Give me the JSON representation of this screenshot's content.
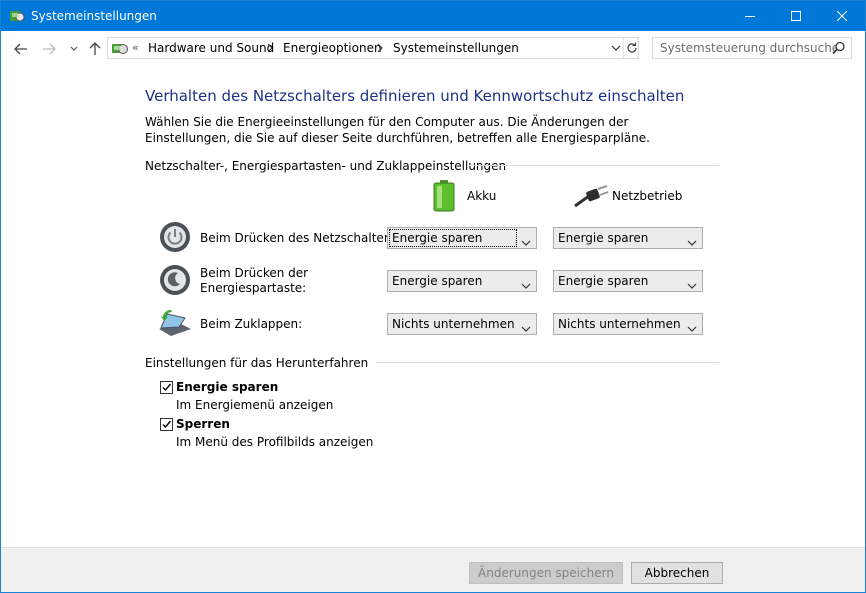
{
  "window": {
    "title": "Systemeinstellungen"
  },
  "address": {
    "overflow": "«",
    "crumbs": [
      "Hardware und Sound",
      "Energieoptionen",
      "Systemeinstellungen"
    ]
  },
  "search": {
    "placeholder": "Systemsteuerung durchsuchen"
  },
  "main": {
    "heading": "Verhalten des Netzschalters definieren und Kennwortschutz einschalten",
    "intro": "Wählen Sie die Energieeinstellungen für den Computer aus. Die Änderungen der Einstellungen, die Sie auf dieser Seite durchführen, betreffen alle Energiesparpläne.",
    "group1_title": "Netzschalter-, Energiespartasten- und Zuklappeinstellungen",
    "columns": {
      "battery": "Akku",
      "plugged": "Netzbetrieb"
    },
    "rows": [
      {
        "label": "Beim Drücken des Netzschalters:",
        "battery": "Energie sparen",
        "plugged": "Energie sparen"
      },
      {
        "label": "Beim Drücken der Energiespartaste:",
        "battery": "Energie sparen",
        "plugged": "Energie sparen"
      },
      {
        "label": "Beim Zuklappen:",
        "battery": "Nichts unternehmen",
        "plugged": "Nichts unternehmen"
      }
    ],
    "group2_title": "Einstellungen für das Herunterfahren",
    "shutdown": [
      {
        "label": "Energie sparen",
        "desc": "Im Energiemenü anzeigen",
        "checked": true
      },
      {
        "label": "Sperren",
        "desc": "Im Menü des Profilbilds anzeigen",
        "checked": true
      }
    ]
  },
  "footer": {
    "save": "Änderungen speichern",
    "cancel": "Abbrechen"
  },
  "colors": {
    "titlebar": "#0078d7",
    "heading": "#1e3287",
    "footer": "#f0f0f0"
  }
}
